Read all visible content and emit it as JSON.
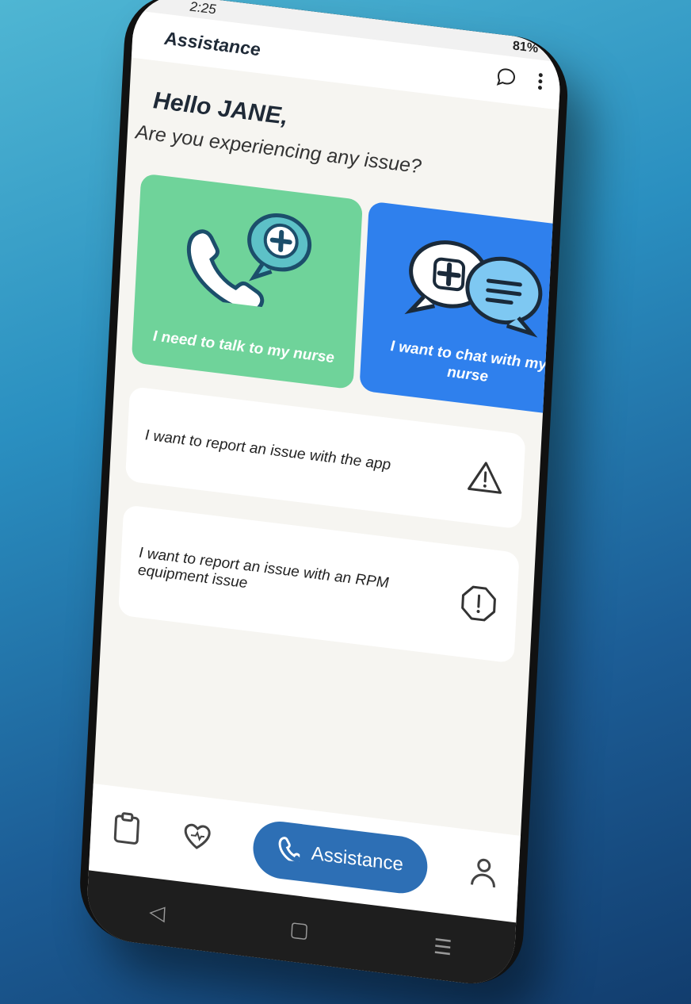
{
  "status": {
    "time": "2:25",
    "right": "🔵 ✶ 41.0 ▴▾ 81%"
  },
  "appbar": {
    "title": "Assistance"
  },
  "greeting": {
    "hello": "Hello JANE,",
    "question": "Are you experiencing any issue?"
  },
  "tiles": [
    {
      "label": "I need to talk to my nurse",
      "icon": "phone-plus-icon"
    },
    {
      "label": "I want to chat with my nurse",
      "icon": "chat-plus-icon"
    }
  ],
  "cards": [
    {
      "label": "I want to report an issue with the app",
      "icon": "warning-icon"
    },
    {
      "label": "I want to report an issue with an RPM equipment issue",
      "icon": "alert-octagon-icon"
    }
  ],
  "nav": {
    "assistance_label": "Assistance"
  }
}
